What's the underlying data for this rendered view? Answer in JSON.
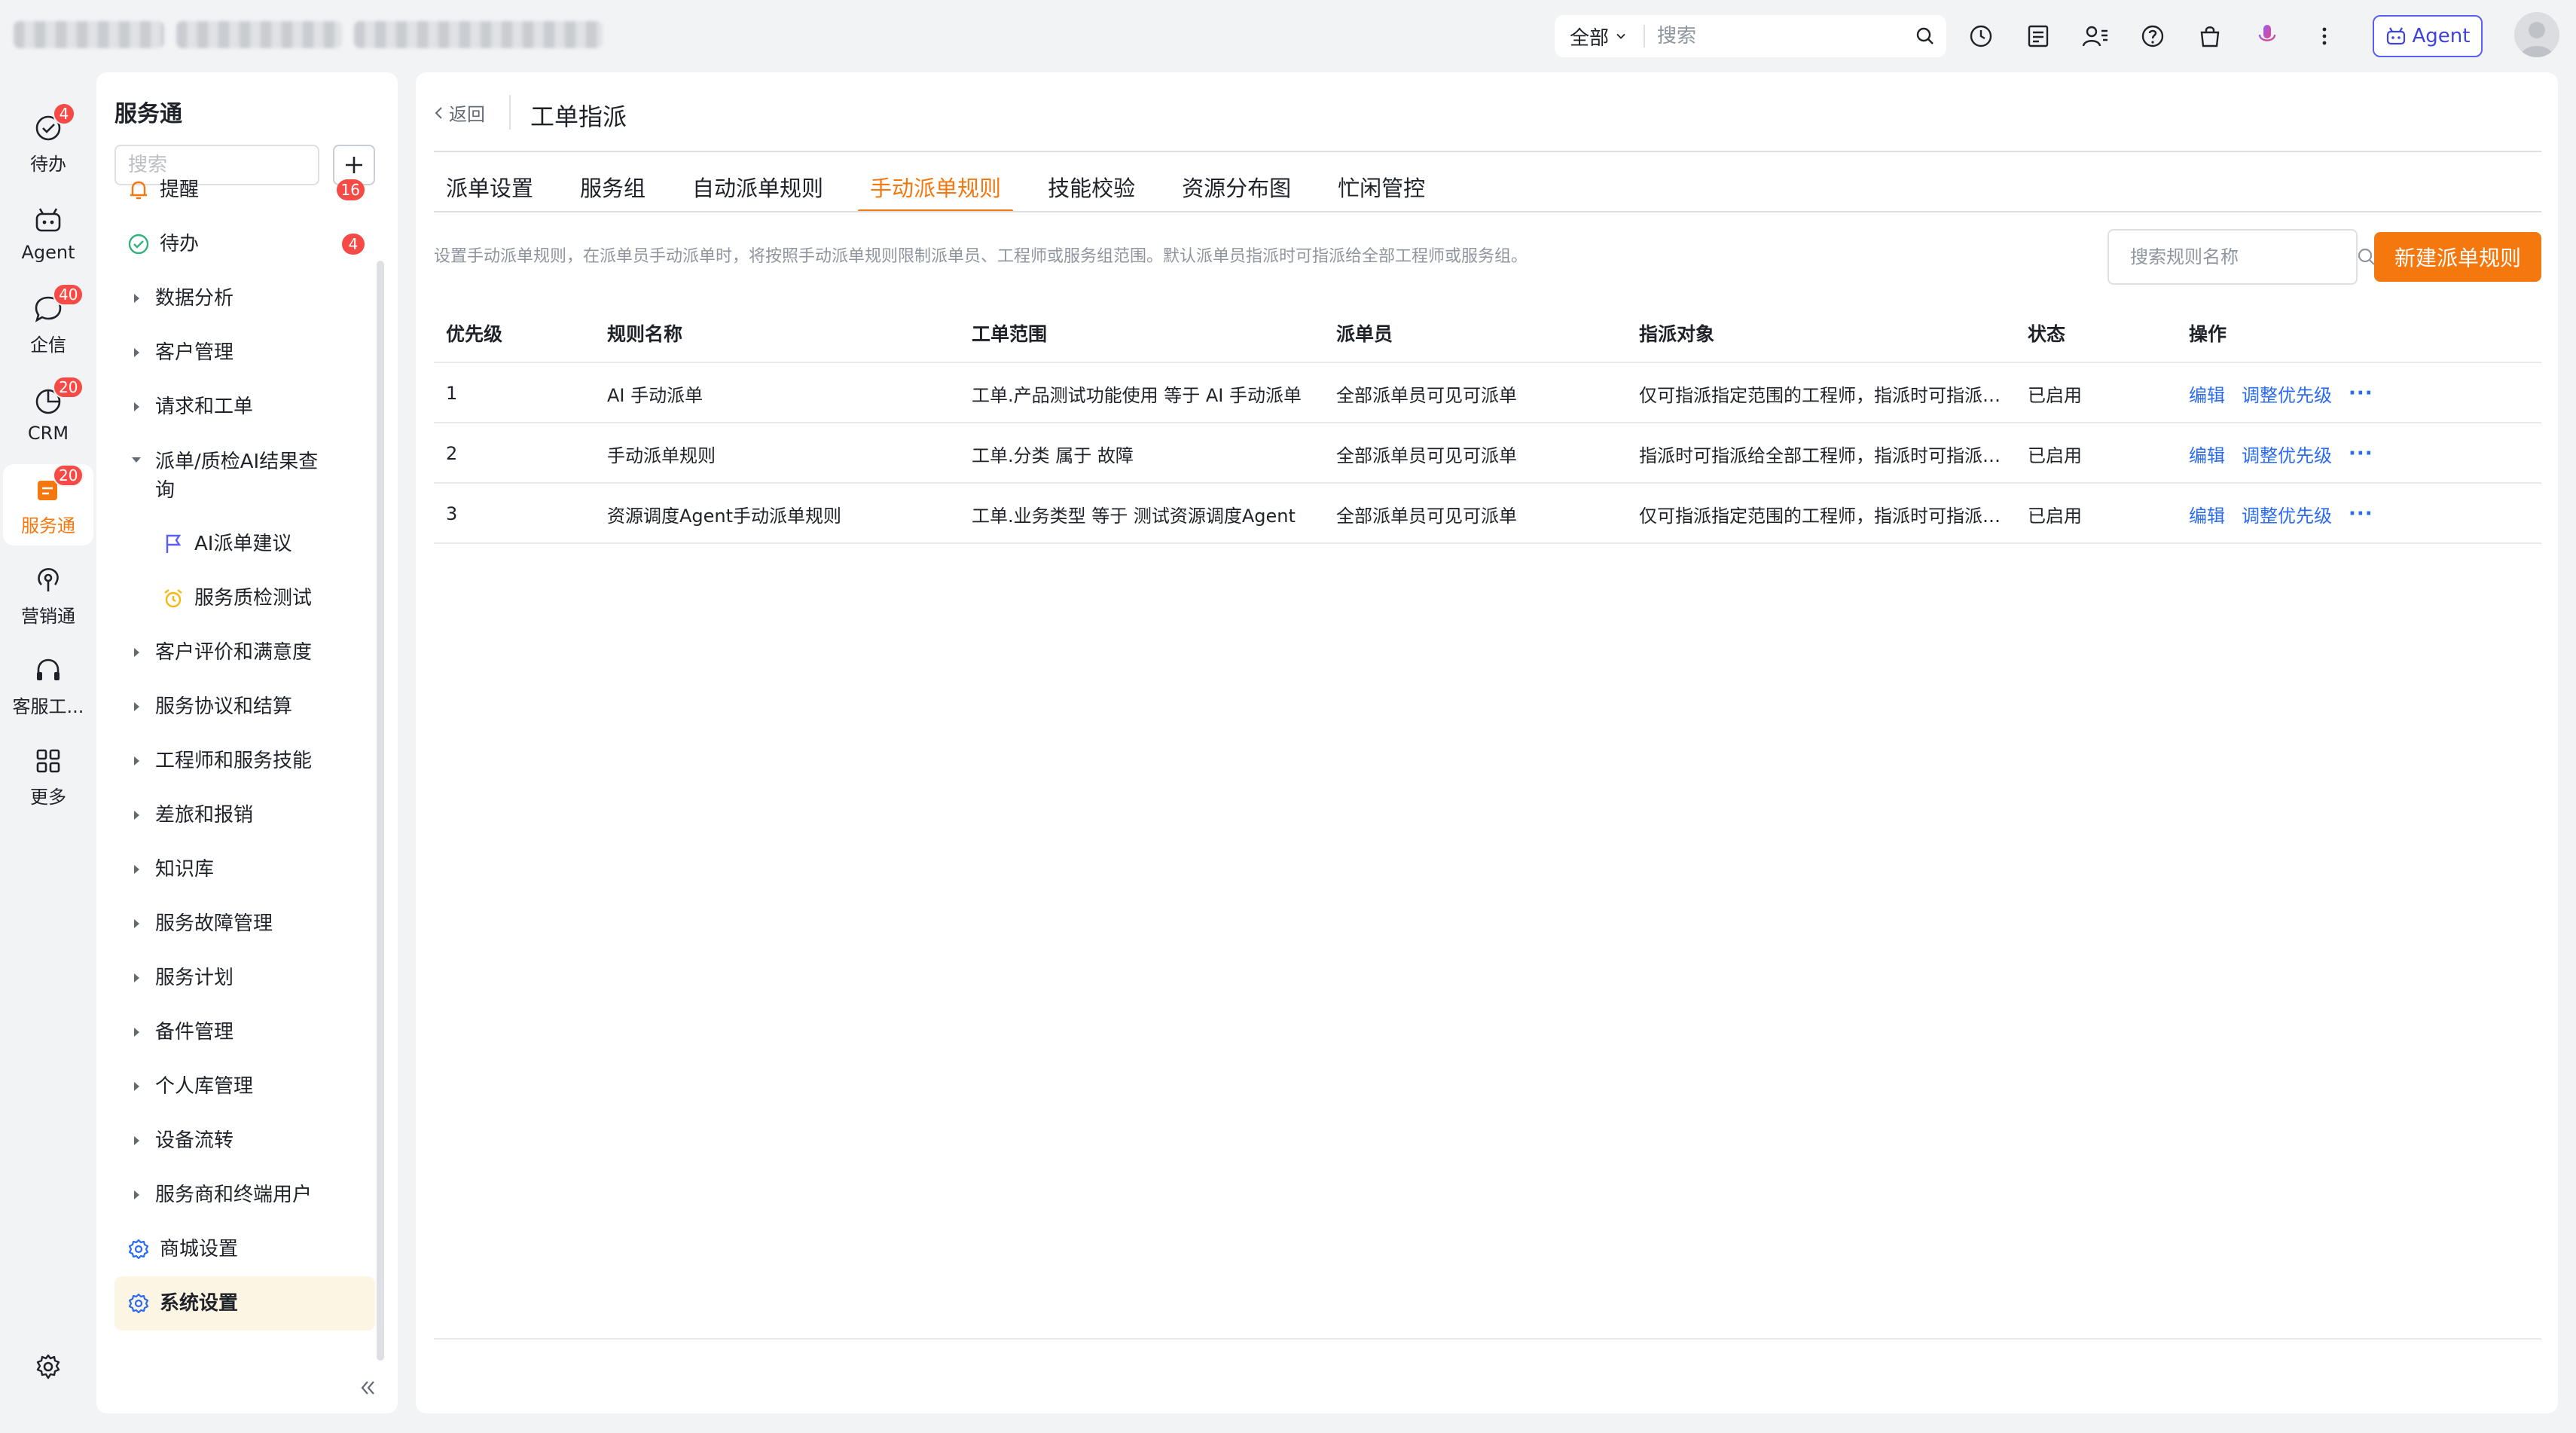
{
  "topbar": {
    "search_scope": "全部",
    "search_placeholder": "搜索",
    "agent_label": "Agent",
    "icons": [
      "clock-icon",
      "notes-icon",
      "contacts-icon",
      "help-icon",
      "bag-icon",
      "mic-icon",
      "more-vertical-icon"
    ]
  },
  "rail": {
    "items": [
      {
        "label": "待办",
        "badge": "4",
        "icon": "todo-icon"
      },
      {
        "label": "Agent",
        "badge": "",
        "icon": "robot-icon"
      },
      {
        "label": "企信",
        "badge": "40",
        "icon": "chat-icon"
      },
      {
        "label": "CRM",
        "badge": "20",
        "icon": "crm-icon"
      },
      {
        "label": "服务通",
        "badge": "20",
        "icon": "service-icon"
      },
      {
        "label": "营销通",
        "badge": "",
        "icon": "broadcast-icon"
      },
      {
        "label": "客服工...",
        "badge": "",
        "icon": "headset-icon"
      },
      {
        "label": "更多",
        "badge": "",
        "icon": "grid-icon"
      }
    ]
  },
  "sidebar": {
    "title": "服务通",
    "search_placeholder": "搜索",
    "items": [
      {
        "label": "提醒",
        "badge": "16"
      },
      {
        "label": "待办",
        "badge": "4"
      },
      {
        "label": "数据分析"
      },
      {
        "label": "客户管理"
      },
      {
        "label": "请求和工单"
      },
      {
        "label": "派单/质检AI结果查询"
      },
      {
        "label": "AI派单建议"
      },
      {
        "label": "服务质检测试"
      },
      {
        "label": "客户评价和满意度"
      },
      {
        "label": "服务协议和结算"
      },
      {
        "label": "工程师和服务技能"
      },
      {
        "label": "差旅和报销"
      },
      {
        "label": "知识库"
      },
      {
        "label": "服务故障管理"
      },
      {
        "label": "服务计划"
      },
      {
        "label": "备件管理"
      },
      {
        "label": "个人库管理"
      },
      {
        "label": "设备流转"
      },
      {
        "label": "服务商和终端用户"
      },
      {
        "label": "商城设置"
      },
      {
        "label": "系统设置"
      }
    ]
  },
  "main": {
    "back_label": "返回",
    "title": "工单指派",
    "tabs": [
      "派单设置",
      "服务组",
      "自动派单规则",
      "手动派单规则",
      "技能校验",
      "资源分布图",
      "忙闲管控"
    ],
    "description": "设置手动派单规则，在派单员手动派单时，将按照手动派单规则限制派单员、工程师或服务组范围。默认派单员指派时可指派给全部工程师或服务组。",
    "rule_search_placeholder": "搜索规则名称",
    "new_button": "新建派单规则",
    "columns": [
      "优先级",
      "规则名称",
      "工单范围",
      "派单员",
      "指派对象",
      "状态",
      "操作"
    ],
    "rows": [
      {
        "priority": "1",
        "name": "AI 手动派单",
        "scope": "工单.产品测试功能使用 等于 AI 手动派单",
        "dispatcher": "全部派单员可见可派单",
        "target": "仅可指派指定范围的工程师，指派时可指派给全部服务组",
        "status": "已启用",
        "edit": "编辑",
        "adjust": "调整优先级",
        "more": "···"
      },
      {
        "priority": "2",
        "name": "手动派单规则",
        "scope": "工单.分类 属于 故障",
        "dispatcher": "全部派单员可见可派单",
        "target": "指派时可指派给全部工程师，指派时可指派给全部服务组",
        "status": "已启用",
        "edit": "编辑",
        "adjust": "调整优先级",
        "more": "···"
      },
      {
        "priority": "3",
        "name": "资源调度Agent手动派单规则",
        "scope": "工单.业务类型 等于 测试资源调度Agent",
        "dispatcher": "全部派单员可见可派单",
        "target": "仅可指派指定范围的工程师，指派时可指派给全部服务组",
        "status": "已启用",
        "edit": "编辑",
        "adjust": "调整优先级",
        "more": "···"
      }
    ]
  },
  "colors": {
    "accent": "#f5780e",
    "link": "#2a6bf2",
    "badge": "#f54a45",
    "agent_border": "#5b5ef5"
  }
}
